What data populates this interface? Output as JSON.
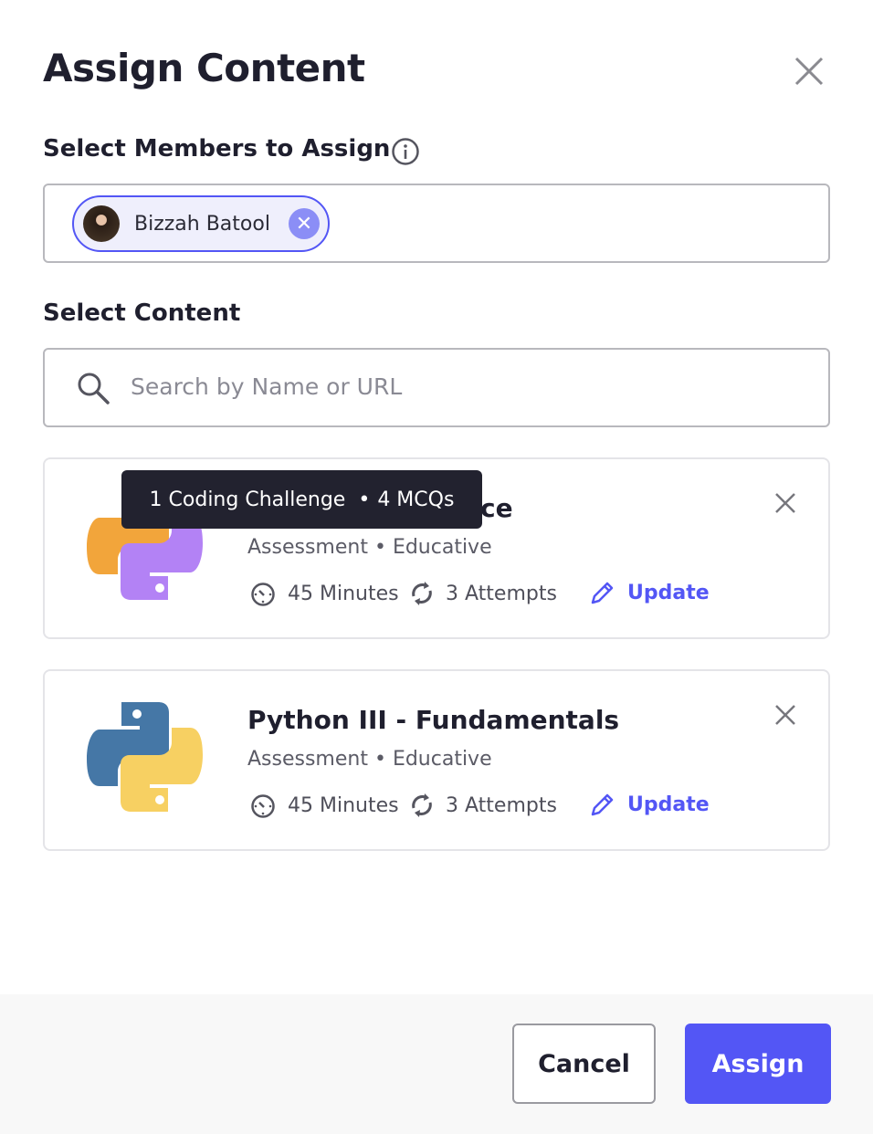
{
  "dialog": {
    "title": "Assign Content"
  },
  "members": {
    "label": "Select Members to Assign",
    "selected": [
      {
        "name": "Bizzah Batool"
      }
    ]
  },
  "content": {
    "label": "Select Content",
    "search_placeholder": "Search by Name or URL",
    "items": [
      {
        "title_visible": "ce",
        "type": "Assessment",
        "provider": "Educative",
        "duration": "45 Minutes",
        "attempts": "3 Attempts",
        "update_label": "Update",
        "logo_colors": [
          "#f2a53b",
          "#b382f5"
        ],
        "tooltip": {
          "challenges": "1 Coding Challenge",
          "mcqs": "4 MCQs"
        }
      },
      {
        "title": "Python III - Fundamentals",
        "type": "Assessment",
        "provider": "Educative",
        "duration": "45 Minutes",
        "attempts": "3 Attempts",
        "update_label": "Update",
        "logo_colors": [
          "#4577a6",
          "#f7d062"
        ]
      }
    ]
  },
  "footer": {
    "cancel": "Cancel",
    "assign": "Assign"
  },
  "colors": {
    "accent": "#5356f5",
    "tooltip_bg": "#22222f"
  }
}
